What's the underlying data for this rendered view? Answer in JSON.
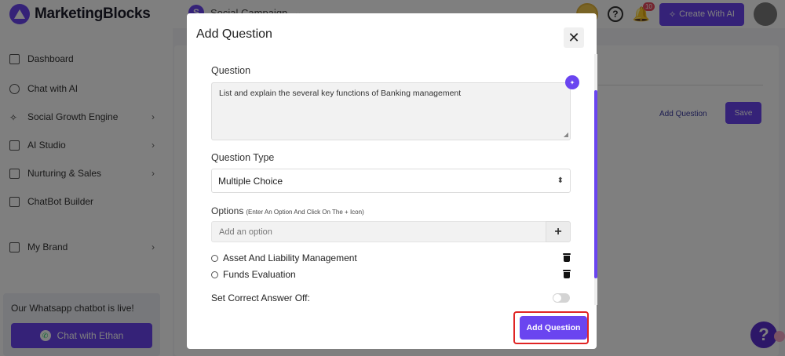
{
  "app": {
    "brand": "MarketingBlocks",
    "campaign_name": "Social Campaign",
    "campaign_initial": "S",
    "notification_count": "10",
    "create_ai_label": "Create With AI"
  },
  "sidebar": {
    "items": [
      {
        "label": "Dashboard"
      },
      {
        "label": "Chat with AI"
      },
      {
        "label": "Social Growth Engine"
      },
      {
        "label": "AI Studio"
      },
      {
        "label": "Nurturing & Sales"
      },
      {
        "label": "ChatBot Builder"
      },
      {
        "label": "My Brand"
      }
    ],
    "whatsapp_text": "Our Whatsapp chatbot is live!",
    "whatsapp_button": "Chat with Ethan"
  },
  "main": {
    "add_question_link": "Add Question",
    "save_label": "Save"
  },
  "modal": {
    "title": "Add Question",
    "question_label": "Question",
    "question_value": "List and explain the several key functions of Banking management",
    "type_label": "Question Type",
    "type_value": "Multiple Choice",
    "options_label": "Options",
    "options_hint": "(Enter An Option And Click On The + Icon)",
    "option_placeholder": "Add an option",
    "options": [
      {
        "label": "Asset And Liability Management"
      },
      {
        "label": "Funds Evaluation"
      }
    ],
    "correct_answer_label": "Set Correct Answer Off:",
    "submit_label": "Add Question"
  },
  "colors": {
    "accent": "#6a45f0",
    "highlight": "#e02424"
  }
}
